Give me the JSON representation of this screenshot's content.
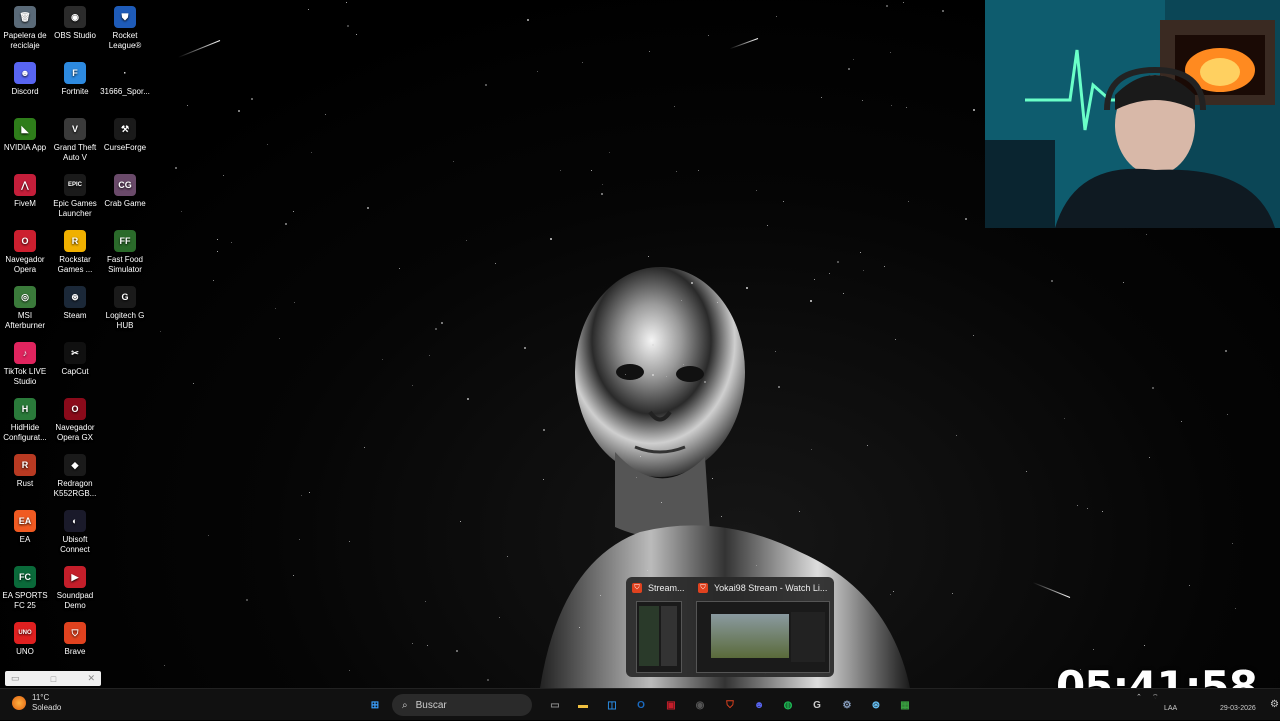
{
  "desktop": {
    "icons": [
      {
        "label": "Papelera de reciclaje",
        "icon": "recycle-bin-icon",
        "color": "#5a6a78",
        "glyph": "🗑"
      },
      {
        "label": "OBS Studio",
        "icon": "obs-icon",
        "color": "#2b2b2b",
        "glyph": "◉"
      },
      {
        "label": "Rocket League®",
        "icon": "rocket-league-icon",
        "color": "#1e5bb8",
        "glyph": "⛊"
      },
      {
        "label": "Discord",
        "icon": "discord-icon",
        "color": "#5865f2",
        "glyph": "☻"
      },
      {
        "label": "Fortnite",
        "icon": "fortnite-icon",
        "color": "#2d8ae0",
        "glyph": "F"
      },
      {
        "label": "31666_Spor...",
        "icon": "file-icon",
        "color": "#000000",
        "glyph": "·"
      },
      {
        "label": "NVIDIA App",
        "icon": "nvidia-icon",
        "color": "#2e7d1a",
        "glyph": "◣"
      },
      {
        "label": "Grand Theft Auto V",
        "icon": "gta-icon",
        "color": "#3a3a3a",
        "glyph": "V"
      },
      {
        "label": "CurseForge",
        "icon": "curseforge-icon",
        "color": "#1a1a1a",
        "glyph": "⚒"
      },
      {
        "label": "FiveM",
        "icon": "fivem-icon",
        "color": "#c41e3a",
        "glyph": "⋀"
      },
      {
        "label": "Epic Games Launcher",
        "icon": "epic-games-icon",
        "color": "#1a1a1a",
        "glyph": "EPIC"
      },
      {
        "label": "Crab Game",
        "icon": "crab-game-icon",
        "color": "#6a4a6a",
        "glyph": "CG"
      },
      {
        "label": "Navegador Opera",
        "icon": "opera-icon",
        "color": "#cc1f2f",
        "glyph": "O"
      },
      {
        "label": "Rockstar Games ...",
        "icon": "rockstar-icon",
        "color": "#f0b000",
        "glyph": "R"
      },
      {
        "label": "Fast Food Simulator",
        "icon": "fast-food-simulator-icon",
        "color": "#2a6a2a",
        "glyph": "FF"
      },
      {
        "label": "MSI Afterburner",
        "icon": "msi-afterburner-icon",
        "color": "#3a7a3a",
        "glyph": "◎"
      },
      {
        "label": "Steam",
        "icon": "steam-icon",
        "color": "#1b2838",
        "glyph": "⊛"
      },
      {
        "label": "Logitech G HUB",
        "icon": "logitech-ghub-icon",
        "color": "#1a1a1a",
        "glyph": "G"
      },
      {
        "label": "TikTok LIVE Studio",
        "icon": "tiktok-live-icon",
        "color": "#e0245e",
        "glyph": "♪"
      },
      {
        "label": "CapCut",
        "icon": "capcut-icon",
        "color": "#101010",
        "glyph": "✂"
      },
      {
        "label": "",
        "icon": "",
        "color": "",
        "glyph": ""
      },
      {
        "label": "HidHide Configurat...",
        "icon": "hidhide-icon",
        "color": "#2a7a3a",
        "glyph": "H"
      },
      {
        "label": "Navegador Opera GX",
        "icon": "opera-gx-icon",
        "color": "#8a0a1a",
        "glyph": "O"
      },
      {
        "label": "",
        "icon": "",
        "color": "",
        "glyph": ""
      },
      {
        "label": "Rust",
        "icon": "rust-icon",
        "color": "#b83a22",
        "glyph": "R"
      },
      {
        "label": "Redragon K552RGB...",
        "icon": "redragon-icon",
        "color": "#1a1a1a",
        "glyph": "◆"
      },
      {
        "label": "",
        "icon": "",
        "color": "",
        "glyph": ""
      },
      {
        "label": "EA",
        "icon": "ea-icon",
        "color": "#f05a22",
        "glyph": "EA"
      },
      {
        "label": "Ubisoft Connect",
        "icon": "ubisoft-connect-icon",
        "color": "#1a1a2a",
        "glyph": "◐"
      },
      {
        "label": "",
        "icon": "",
        "color": "",
        "glyph": ""
      },
      {
        "label": "EA SPORTS FC 25",
        "icon": "ea-sports-fc-icon",
        "color": "#0a6a3a",
        "glyph": "FC"
      },
      {
        "label": "Soundpad Demo",
        "icon": "soundpad-icon",
        "color": "#c41e2a",
        "glyph": "▶"
      },
      {
        "label": "",
        "icon": "",
        "color": "",
        "glyph": ""
      },
      {
        "label": "UNO",
        "icon": "uno-icon",
        "color": "#e02020",
        "glyph": "UNO"
      },
      {
        "label": "Brave",
        "icon": "brave-icon",
        "color": "#e0421f",
        "glyph": "⛉"
      },
      {
        "label": "",
        "icon": "",
        "color": "",
        "glyph": ""
      }
    ]
  },
  "thumbnail_preview": {
    "items": [
      {
        "title": "Stream..."
      },
      {
        "title": "Yokai98 Stream - Watch Li..."
      }
    ]
  },
  "clock_overlay": {
    "time": "05:41:58"
  },
  "taskbar": {
    "weather": {
      "temp": "11°C",
      "condition": "Soleado"
    },
    "search_placeholder": "Buscar",
    "apps": [
      {
        "name": "start-button",
        "glyph": "⊞",
        "color": "#3aa0ff"
      },
      {
        "name": "task-view-button",
        "glyph": "▭",
        "color": "#888888"
      },
      {
        "name": "file-explorer-button",
        "glyph": "▬",
        "color": "#f0c040"
      },
      {
        "name": "microsoft-store-button",
        "glyph": "◫",
        "color": "#2a8ae0"
      },
      {
        "name": "outlook-button",
        "glyph": "O",
        "color": "#1a6ac0"
      },
      {
        "name": "app-red-button",
        "glyph": "▣",
        "color": "#c41e2a"
      },
      {
        "name": "obs-button",
        "glyph": "◉",
        "color": "#555555"
      },
      {
        "name": "brave-button",
        "glyph": "⛉",
        "color": "#e0421f"
      },
      {
        "name": "discord-button",
        "glyph": "☻",
        "color": "#5865f2"
      },
      {
        "name": "spotify-button",
        "glyph": "◍",
        "color": "#1db954"
      },
      {
        "name": "logitech-ghub-button",
        "glyph": "G",
        "color": "#cccccc"
      },
      {
        "name": "settings-button",
        "glyph": "⚙",
        "color": "#8aa0c0"
      },
      {
        "name": "steam-button",
        "glyph": "⊛",
        "color": "#66c0f4"
      },
      {
        "name": "minecraft-button",
        "glyph": "▦",
        "color": "#3aa040"
      }
    ],
    "tray": {
      "lang": "LAA",
      "date": "29-03-2026"
    }
  },
  "mini_window": {
    "icon_left": "▭",
    "icon_mid": "□",
    "icon_close": "✕"
  }
}
